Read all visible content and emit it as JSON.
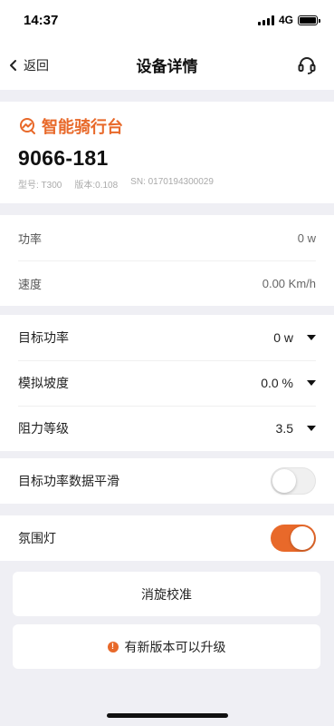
{
  "status_bar": {
    "time": "14:37",
    "network": "4G"
  },
  "nav": {
    "back_label": "返回",
    "title": "设备详情",
    "support_icon": "headset-icon"
  },
  "device": {
    "brand": "智能骑行台",
    "name": "9066-181",
    "model": "型号: T300",
    "version": "版本:0.108",
    "sn": "SN: 0170194300029"
  },
  "live": {
    "power_label": "功率",
    "power_value": "0 w",
    "speed_label": "速度",
    "speed_value": "0.00 Km/h"
  },
  "settings": {
    "target_power_label": "目标功率",
    "target_power_value": "0 w",
    "slope_label": "模拟坡度",
    "slope_value": "0.0 %",
    "resistance_label": "阻力等级",
    "resistance_value": "3.5"
  },
  "smoothing": {
    "label": "目标功率数据平滑",
    "enabled": false
  },
  "ambient_light": {
    "label": "氛围灯",
    "enabled": true
  },
  "buttons": {
    "calibrate": "消旋校准",
    "upgrade": "有新版本可以升级",
    "upgrade_icon_glyph": "!"
  },
  "colors": {
    "accent": "#e8692a",
    "background": "#efeff4"
  }
}
